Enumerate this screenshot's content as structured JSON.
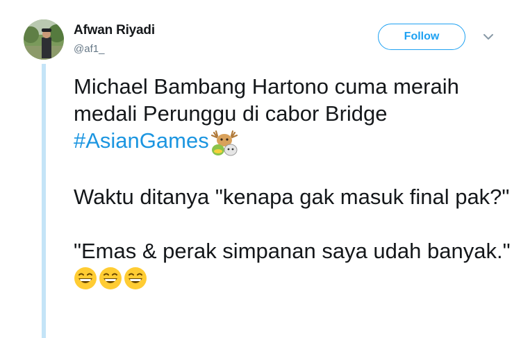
{
  "author": {
    "display_name": "Afwan Riyadi",
    "handle": "@af1_"
  },
  "actions": {
    "follow_label": "Follow",
    "menu_icon": "chevron-down-icon"
  },
  "tweet": {
    "line1": "Michael Bambang Hartono cuma meraih medali Perunggu di cabor Bridge",
    "hashtag": "#AsianGames",
    "hashtag_emoji": "asian-games-mascot-icon",
    "line2": "Waktu ditanya \"kenapa gak masuk final pak?\"",
    "line3": "\"Emas & perak simpanan saya udah banyak.\"",
    "line3_emojis": [
      "grinning-face-icon",
      "grinning-face-icon",
      "grinning-face-icon"
    ]
  },
  "colors": {
    "accent": "#1da1f2",
    "hashtag": "#1b95e0",
    "thread_line": "#c4e4f7",
    "text": "#14171a",
    "muted": "#657786"
  }
}
